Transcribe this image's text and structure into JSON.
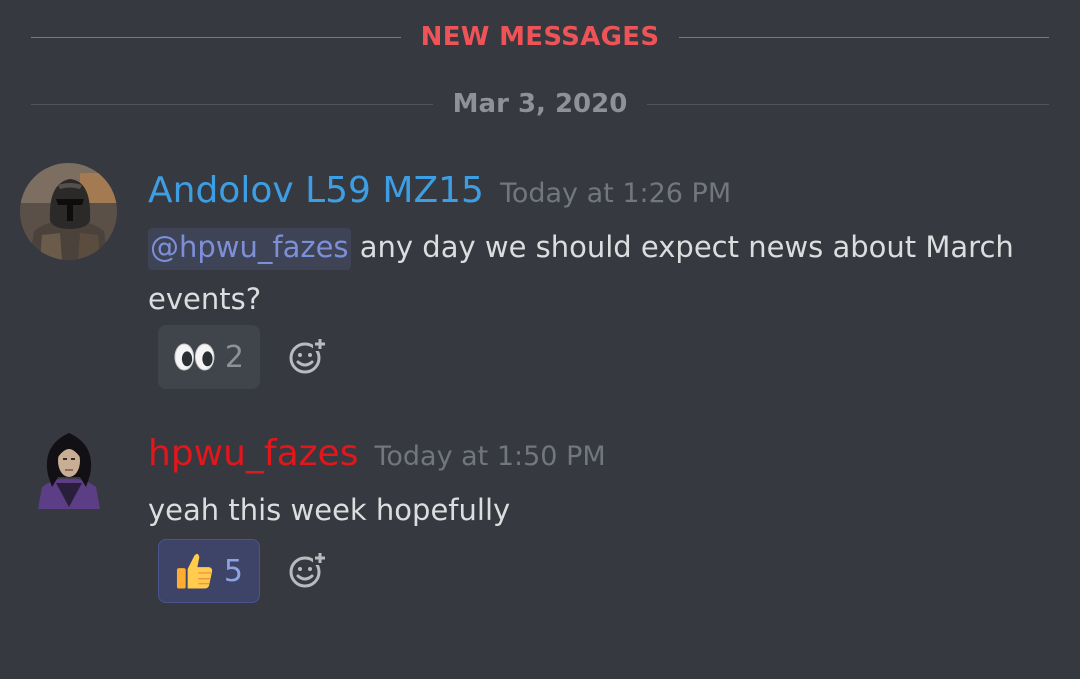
{
  "dividers": {
    "new_messages": "NEW MESSAGES",
    "date": "Mar 3, 2020"
  },
  "messages": [
    {
      "author": "Andolov L59 MZ15",
      "author_color": "#3d9ee4",
      "timestamp": "Today at 1:26 PM",
      "mention": "@hpwu_fazes",
      "text": " any day we should expect news about March events?",
      "avatar_icon": "armored-helmet-avatar",
      "reaction": {
        "emoji": "eyes-emoji",
        "count": "2",
        "reacted_by_me": false
      }
    },
    {
      "author": "hpwu_fazes",
      "author_color": "#e2161b",
      "timestamp": "Today at 1:50 PM",
      "text": "yeah this week hopefully",
      "avatar_icon": "dark-haired-wizard-avatar",
      "reaction": {
        "emoji": "thumbs-up-emoji",
        "count": "5",
        "reacted_by_me": true
      }
    }
  ],
  "colors": {
    "background": "#36393f",
    "new_messages_accent": "#ed5357",
    "mention_text": "#7d8fd9",
    "body_text": "#dcddde",
    "timestamp": "#72767d"
  }
}
